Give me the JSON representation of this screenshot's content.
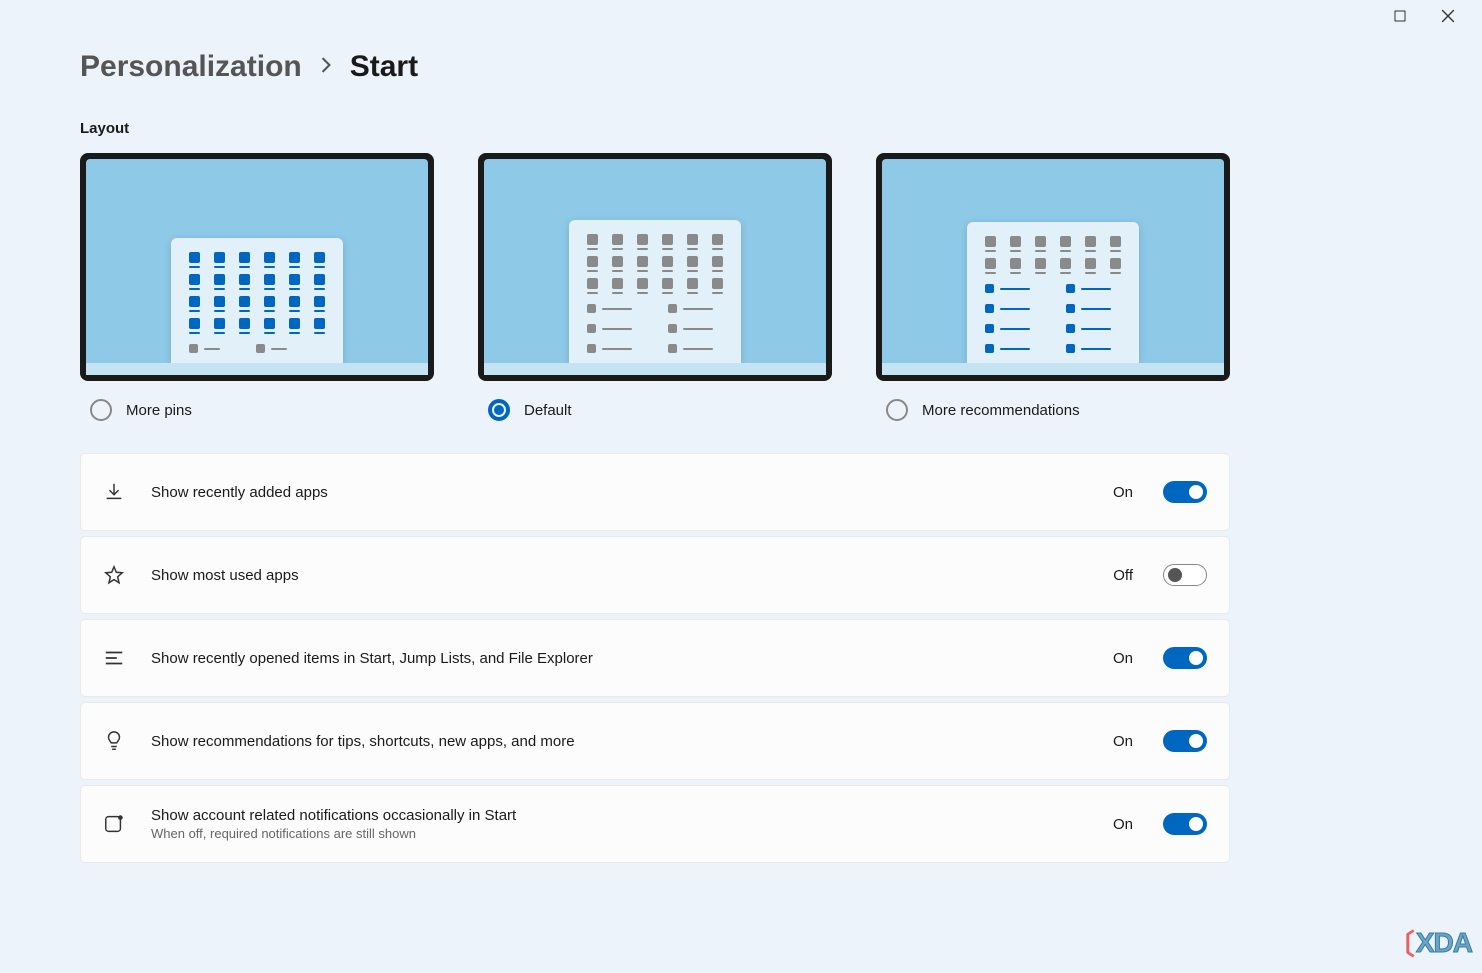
{
  "breadcrumb": {
    "parent": "Personalization",
    "current": "Start"
  },
  "section_label": "Layout",
  "layout_options": [
    {
      "id": "more-pins",
      "label": "More pins",
      "selected": false
    },
    {
      "id": "default",
      "label": "Default",
      "selected": true
    },
    {
      "id": "more-recs",
      "label": "More recommendations",
      "selected": false
    }
  ],
  "toggle_labels": {
    "on": "On",
    "off": "Off"
  },
  "settings": [
    {
      "icon": "download",
      "title": "Show recently added apps",
      "subtitle": "",
      "state": true
    },
    {
      "icon": "star",
      "title": "Show most used apps",
      "subtitle": "",
      "state": false
    },
    {
      "icon": "list",
      "title": "Show recently opened items in Start, Jump Lists, and File Explorer",
      "subtitle": "",
      "state": true
    },
    {
      "icon": "bulb",
      "title": "Show recommendations for tips, shortcuts, new apps, and more",
      "subtitle": "",
      "state": true
    },
    {
      "icon": "account",
      "title": "Show account related notifications occasionally in Start",
      "subtitle": "When off, required notifications are still shown",
      "state": true
    }
  ],
  "watermark": "XDA"
}
